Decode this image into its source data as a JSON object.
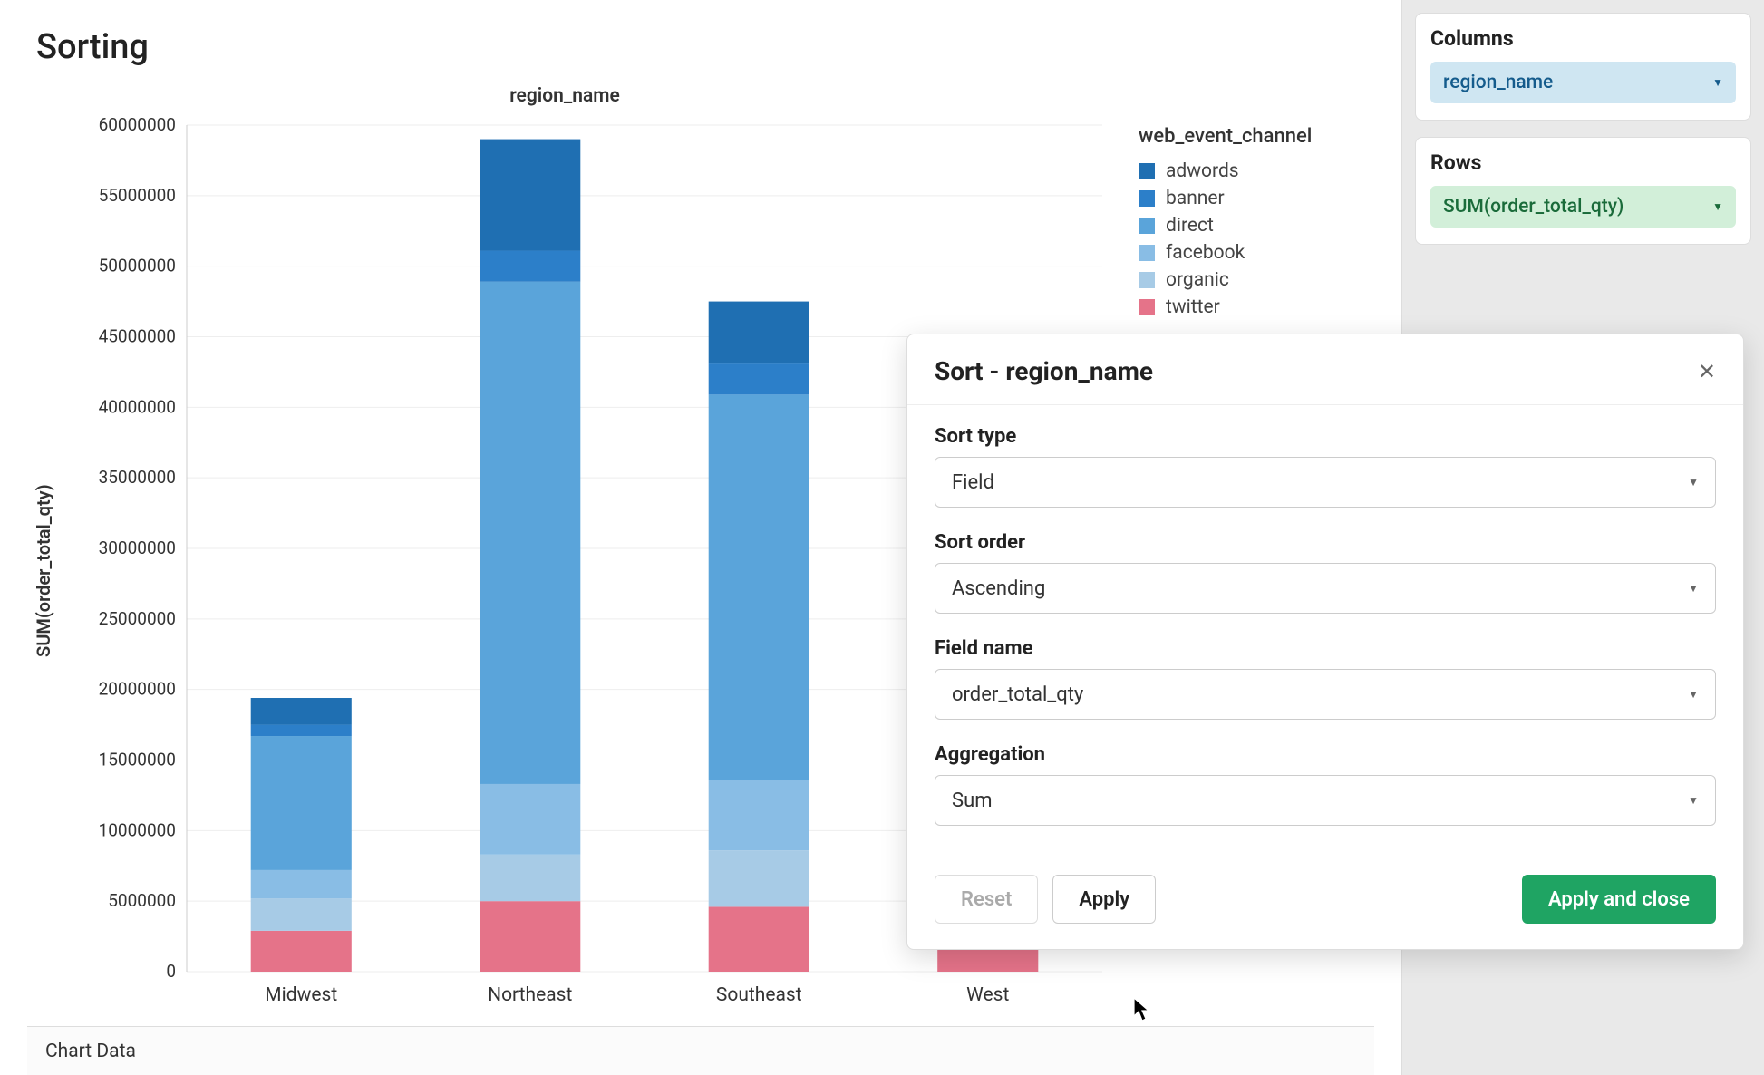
{
  "chart": {
    "title": "Sorting",
    "subtitle": "region_name",
    "ylabel": "SUM(order_total_qty)",
    "legend_title": "web_event_channel"
  },
  "bottom_bar": {
    "label": "Chart Data"
  },
  "side": {
    "columns": {
      "title": "Columns",
      "pill": "region_name"
    },
    "rows": {
      "title": "Rows",
      "pill": "SUM(order_total_qty)"
    }
  },
  "modal": {
    "title": "Sort - region_name",
    "sort_type": {
      "label": "Sort type",
      "value": "Field"
    },
    "sort_order": {
      "label": "Sort order",
      "value": "Ascending"
    },
    "field_name": {
      "label": "Field name",
      "value": "order_total_qty"
    },
    "aggregation": {
      "label": "Aggregation",
      "value": "Sum"
    },
    "reset": "Reset",
    "apply": "Apply",
    "apply_close": "Apply and close"
  },
  "chart_data": {
    "type": "bar",
    "stacked": true,
    "title": "region_name",
    "xlabel": "",
    "ylabel": "SUM(order_total_qty)",
    "ylim": [
      0,
      60000000
    ],
    "yticks": [
      0,
      5000000,
      10000000,
      15000000,
      20000000,
      25000000,
      30000000,
      35000000,
      40000000,
      45000000,
      50000000,
      55000000,
      60000000
    ],
    "categories": [
      "Midwest",
      "Northeast",
      "Southeast",
      "West"
    ],
    "series": [
      {
        "name": "adwords",
        "color": "#1f6fb2",
        "values": [
          1900000,
          7900000,
          4400000,
          3700000
        ]
      },
      {
        "name": "banner",
        "color": "#2c7fc9",
        "values": [
          800000,
          2200000,
          2200000,
          1000000
        ]
      },
      {
        "name": "direct",
        "color": "#5aa4da",
        "values": [
          9500000,
          35600000,
          27300000,
          24800000
        ]
      },
      {
        "name": "facebook",
        "color": "#89bde5",
        "values": [
          2000000,
          5000000,
          5000000,
          3500000
        ]
      },
      {
        "name": "organic",
        "color": "#a7cbe6",
        "values": [
          2300000,
          3300000,
          4000000,
          4000000
        ]
      },
      {
        "name": "twitter",
        "color": "#e57389",
        "values": [
          2900000,
          5000000,
          4600000,
          5000000
        ]
      }
    ],
    "series_order_bottom_to_top": [
      "twitter",
      "organic",
      "facebook",
      "direct",
      "banner",
      "adwords"
    ]
  }
}
